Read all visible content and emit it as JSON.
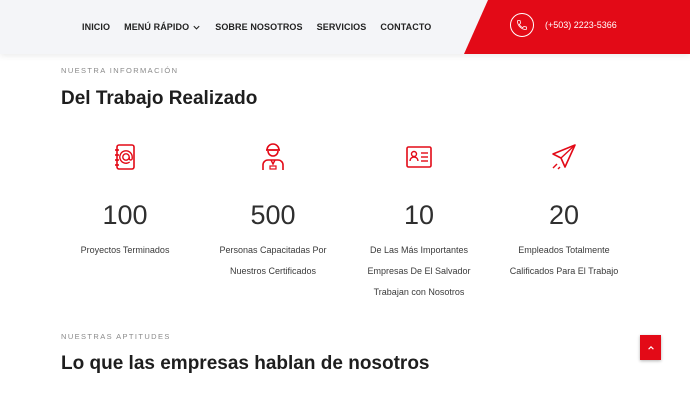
{
  "nav": {
    "items": [
      {
        "label": "INICIO"
      },
      {
        "label": "MENÚ RÁPIDO"
      },
      {
        "label": "SOBRE NOSOTROS"
      },
      {
        "label": "SERVICIOS"
      },
      {
        "label": "CONTACTO"
      }
    ],
    "phone": "(+503) 2223-5366",
    "accent_color": "#e30a17"
  },
  "info_section": {
    "label": "NUESTRA INFORMACIÓN",
    "title": "Del Trabajo Realizado"
  },
  "stats": [
    {
      "icon": "address-book-icon",
      "value": "100",
      "description": "Proyectos Terminados"
    },
    {
      "icon": "worker-icon",
      "value": "500",
      "description": "Personas Capacitadas Por Nuestros Certificados"
    },
    {
      "icon": "id-card-icon",
      "value": "10",
      "description": "De Las Más Importantes Empresas De El Salvador Trabajan con Nosotros"
    },
    {
      "icon": "paper-plane-icon",
      "value": "20",
      "description": "Empleados Totalmente Calificados Para El Trabajo"
    }
  ],
  "skills_section": {
    "label": "NUESTRAS APTITUDES",
    "title": "Lo que las empresas hablan de nosotros"
  }
}
